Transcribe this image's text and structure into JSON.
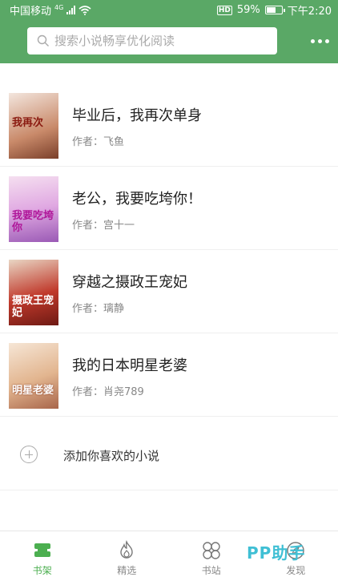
{
  "status_bar": {
    "carrier": "中国移动",
    "network": "4G",
    "hd": "HD",
    "battery": "59%",
    "time": "下午2:20"
  },
  "search": {
    "placeholder": "搜索小说畅享优化阅读",
    "value": ""
  },
  "books": [
    {
      "title": "毕业后，我再次单身",
      "author": "作者：飞鱼",
      "cover_text": "我再次",
      "cover_color": "#c98a6a"
    },
    {
      "title": "老公，我要吃垮你！",
      "author": "作者：宫十一",
      "cover_text": "我要吃垮你",
      "cover_color": "#c58bd6"
    },
    {
      "title": "穿越之摄政王宠妃",
      "author": "作者：璃静",
      "cover_text": "摄政王宠妃",
      "cover_color": "#b8322a"
    },
    {
      "title": "我的日本明星老婆",
      "author": "作者：肖尧789",
      "cover_text": "明星老婆",
      "cover_color": "#d9a585"
    }
  ],
  "add_novel": {
    "label": "添加你喜欢的小说"
  },
  "tabs": [
    {
      "label": "书架",
      "icon": "bookshelf-icon",
      "active": true
    },
    {
      "label": "精选",
      "icon": "flame-icon",
      "active": false
    },
    {
      "label": "书站",
      "icon": "grid-icon",
      "active": false
    },
    {
      "label": "发现",
      "icon": "compass-icon",
      "active": false
    }
  ],
  "watermark": "PP助手",
  "colors": {
    "accent": "#5aa866",
    "active_tab": "#4caf50",
    "inactive_tab": "#888888"
  }
}
